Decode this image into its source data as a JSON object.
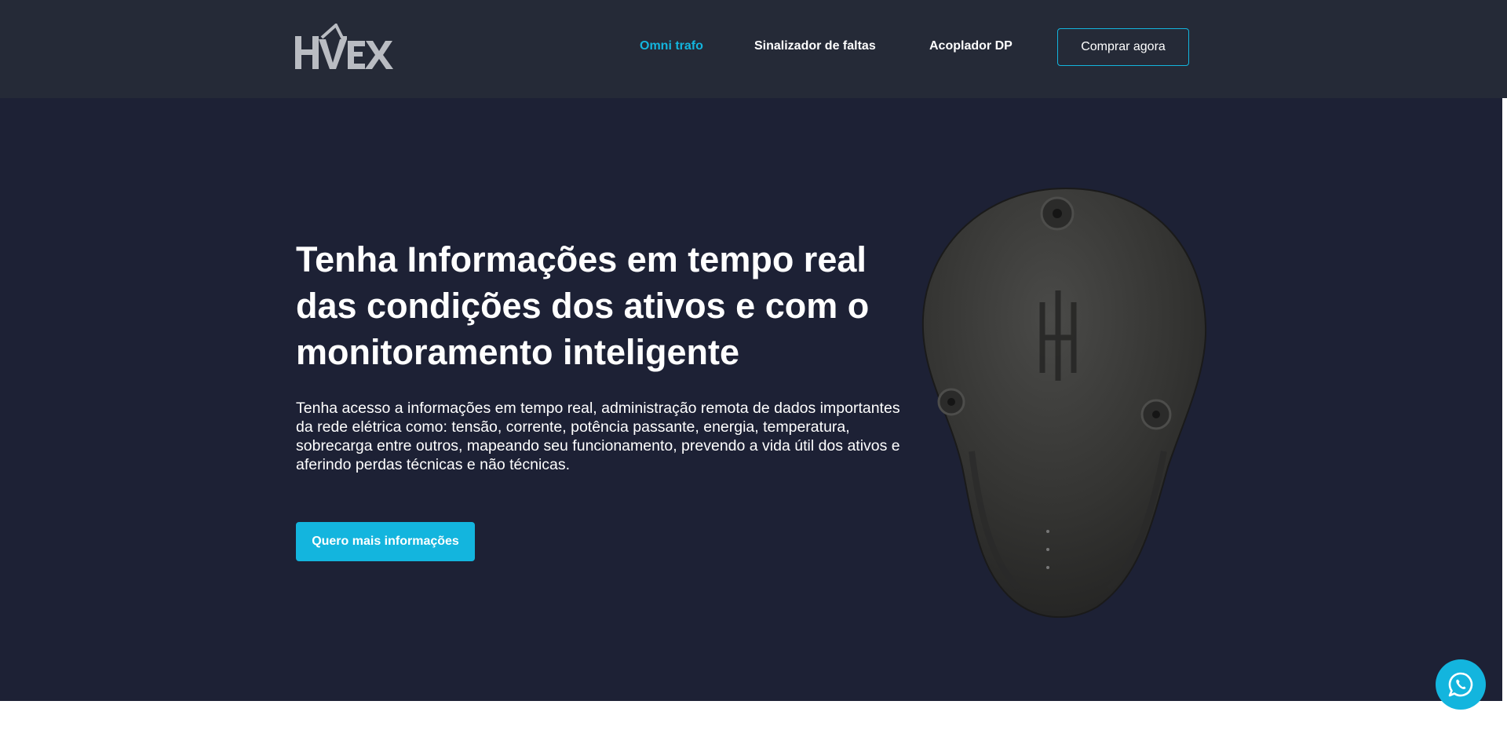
{
  "header": {
    "logo_text": "HVEX",
    "nav": [
      {
        "label": "Omni trafo",
        "active": true
      },
      {
        "label": "Sinalizador de faltas",
        "active": false
      },
      {
        "label": "Acoplador DP",
        "active": false
      }
    ],
    "buy_label": "Comprar agora"
  },
  "hero": {
    "title": "Tenha Informações em tempo real das condições dos ativos e com o monitoramento inteligente",
    "text": "Tenha acesso a informações em tempo real, administração remota de dados importantes da rede elétrica como: tensão, corrente, potência passante, energia, temperatura, sobrecarga entre outros, mapeando seu funcionamento, prevendo a vida útil dos ativos e aferindo perdas técnicas e não técnicas.",
    "cta_label": "Quero mais informações"
  },
  "colors": {
    "header_bg": "#252a37",
    "hero_bg": "#1d2135",
    "accent": "#13b5de"
  },
  "icons": {
    "chat": "whatsapp-icon"
  }
}
